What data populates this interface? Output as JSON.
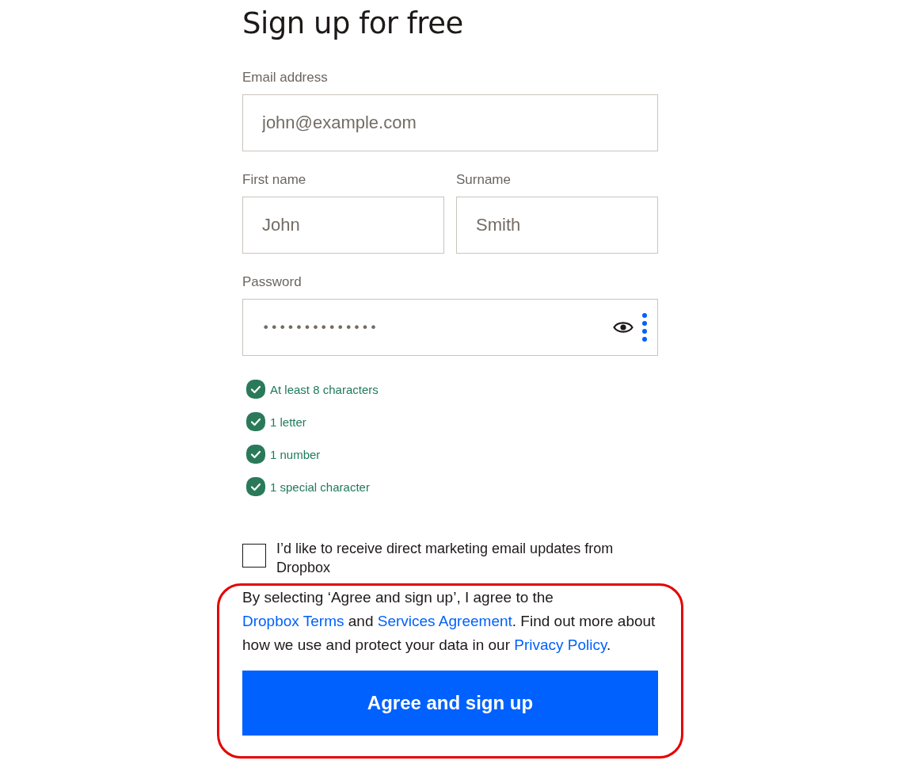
{
  "title": "Sign up for free",
  "email": {
    "label": "Email address",
    "placeholder": "john@example.com"
  },
  "first_name": {
    "label": "First name",
    "placeholder": "John"
  },
  "surname": {
    "label": "Surname",
    "placeholder": "Smith"
  },
  "password": {
    "label": "Password",
    "value": "••••••••••••••"
  },
  "password_rules": [
    {
      "text": "At least 8 characters",
      "met": true
    },
    {
      "text": "1 letter",
      "met": true
    },
    {
      "text": "1 number",
      "met": true
    },
    {
      "text": "1 special character",
      "met": true
    }
  ],
  "marketing": {
    "label": "I’d like to receive direct marketing email updates from Dropbox",
    "checked": false
  },
  "consent": [
    {
      "kind": "text",
      "text": "By selecting ‘Agree and sign up’, I agree to the "
    },
    {
      "kind": "link",
      "text": "Dropbox "
    },
    {
      "kind": "link",
      "text": "Terms"
    },
    {
      "kind": "text",
      "text": " and "
    },
    {
      "kind": "link",
      "text": "Services Agreement"
    },
    {
      "kind": "text",
      "text": ". Find out more about how we use and protect your data in our "
    },
    {
      "kind": "link",
      "text": "Privacy Policy"
    },
    {
      "kind": "text",
      "text": "."
    }
  ],
  "submit": "Agree and sign up"
}
